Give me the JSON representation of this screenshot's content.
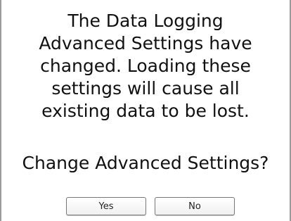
{
  "dialog": {
    "message_lines": [
      "The Data Logging",
      "Advanced Settings have",
      "changed. Loading these",
      "settings will cause all",
      "existing data to be lost."
    ],
    "question": "Change Advanced Settings?",
    "buttons": {
      "yes_label": "Yes",
      "no_label": "No"
    }
  }
}
